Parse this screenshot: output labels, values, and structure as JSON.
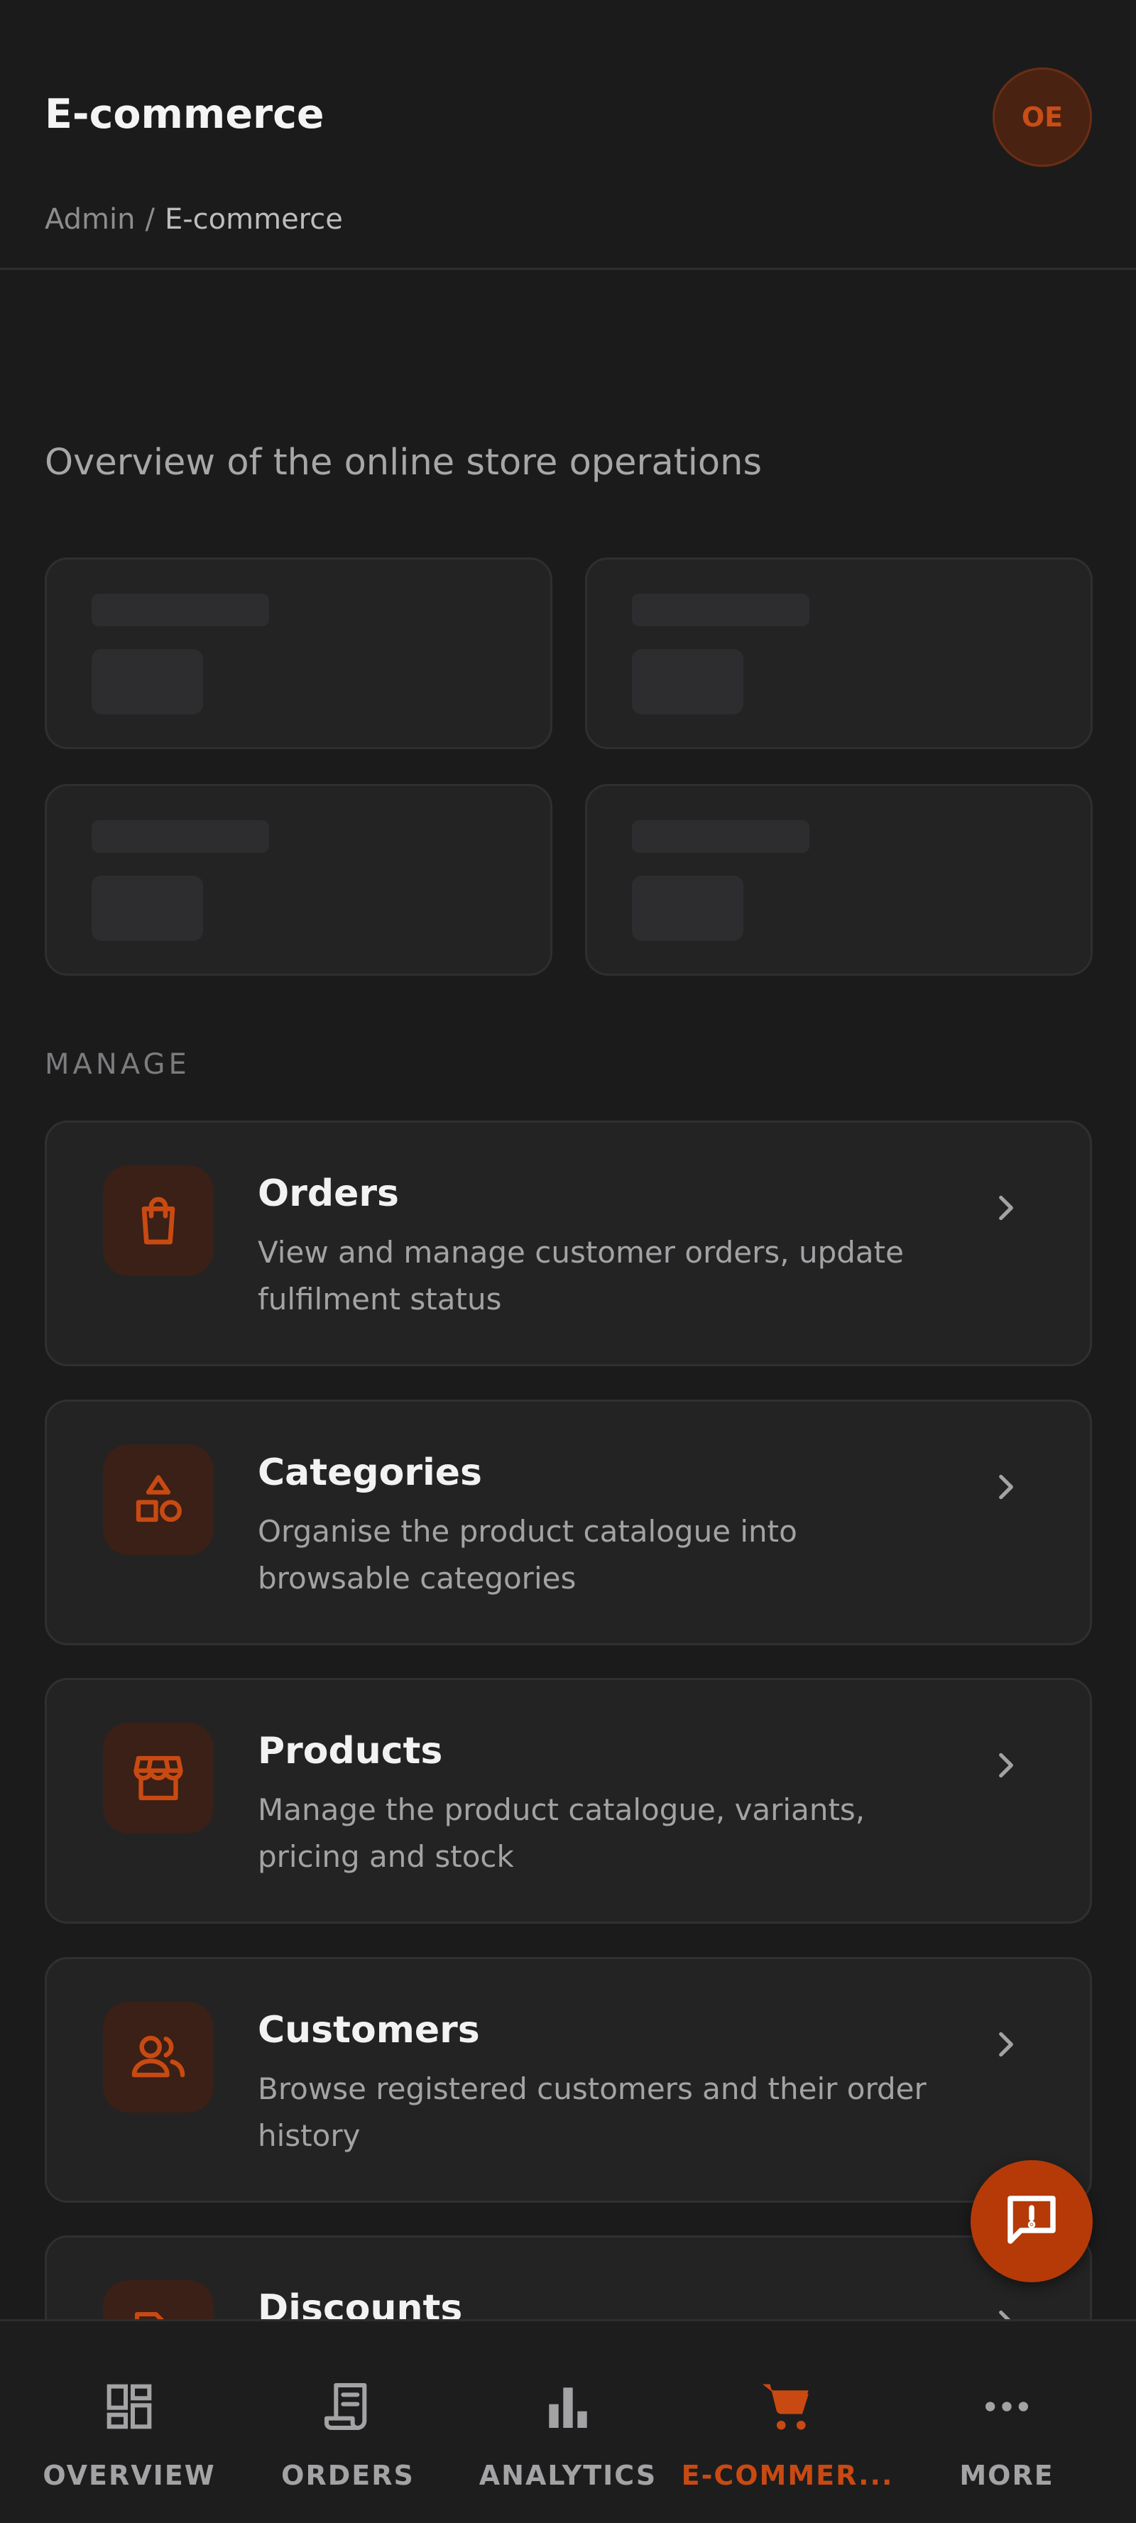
{
  "header": {
    "title": "E-commerce",
    "avatar_initials": "OE",
    "breadcrumb": {
      "root": "Admin",
      "separator": "/",
      "current": "E-commerce"
    }
  },
  "page": {
    "description": "Overview of the online store operations",
    "stat_cards_loading": 4
  },
  "manage": {
    "section_label": "MANAGE",
    "items": [
      {
        "title": "Orders",
        "description": "View and manage customer orders, update fulfilment status",
        "icon": "shopping-bag-icon"
      },
      {
        "title": "Categories",
        "description": "Organise the product catalogue into browsable categories",
        "icon": "shapes-icon"
      },
      {
        "title": "Products",
        "description": "Manage the product catalogue, variants, pricing and stock",
        "icon": "storefront-icon"
      },
      {
        "title": "Customers",
        "description": "Browse registered customers and their order history",
        "icon": "users-icon"
      },
      {
        "title": "Discounts",
        "description": "",
        "icon": "tag-icon"
      }
    ]
  },
  "fab": {
    "icon": "feedback-icon"
  },
  "bottom_nav": {
    "items": [
      {
        "label": "OVERVIEW",
        "icon": "dashboard-icon",
        "active": false
      },
      {
        "label": "ORDERS",
        "icon": "receipt-icon",
        "active": false
      },
      {
        "label": "ANALYTICS",
        "icon": "bar-chart-icon",
        "active": false
      },
      {
        "label": "E-COMMER...",
        "icon": "cart-icon",
        "active": true
      },
      {
        "label": "MORE",
        "icon": "more-icon",
        "active": false
      }
    ]
  },
  "colors": {
    "background": "#1b1b1c",
    "card": "#232324",
    "accent": "#c84a12",
    "accent_bg": "#3a2016",
    "muted_text": "#a3a3a5"
  }
}
